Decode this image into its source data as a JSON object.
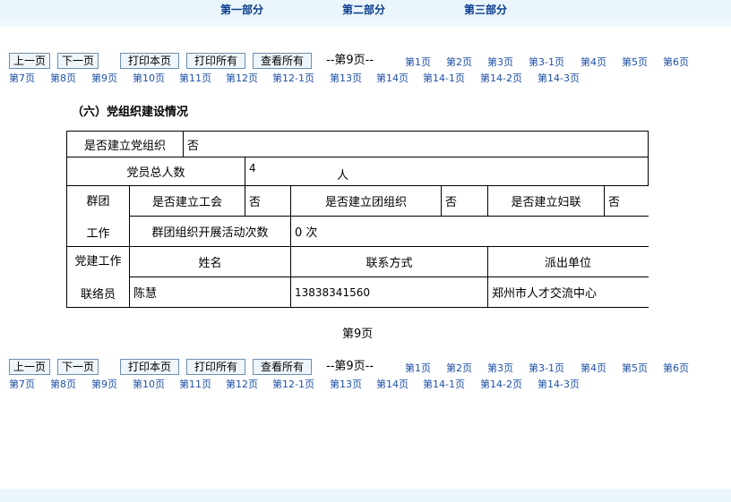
{
  "top_nav": {
    "part1": "第一部分",
    "part2": "第二部分",
    "part3": "第三部分"
  },
  "nav": {
    "prev": "上一页",
    "next": "下一页",
    "print_page": "打印本页",
    "print_all": "打印所有",
    "view_all": "查看所有",
    "current_page": "--第9页--",
    "pages": [
      "第1页",
      "第2页",
      "第3页",
      "第3-1页",
      "第4页",
      "第5页",
      "第6页",
      "第7页",
      "第8页",
      "第9页",
      "第10页",
      "第11页",
      "第12页",
      "第12-1页",
      "第13页",
      "第14页",
      "第14-1页",
      "第14-2页",
      "第14-3页"
    ]
  },
  "section": {
    "title": "（六）党组织建设情况",
    "q_party_org": "是否建立党组织",
    "a_party_org": "否",
    "q_member_count": "党员总人数",
    "a_member_count": "4",
    "member_unit": "人",
    "mass_org_label_1": "群团",
    "mass_org_label_2": "工作",
    "q_union": "是否建立工会",
    "a_union": "否",
    "q_league": "是否建立团组织",
    "a_league": "否",
    "q_women": "是否建立妇联",
    "a_women": "否",
    "q_activities": "群团组织开展活动次数",
    "a_activities": "0 次",
    "liaison_label_1": "党建工作",
    "liaison_label_2": "联络员",
    "col_name": "姓名",
    "col_contact": "联系方式",
    "col_unit": "派出单位",
    "liaison_name": "陈慧",
    "liaison_phone": "13838341560",
    "liaison_unit": "郑州市人才交流中心"
  },
  "footer_page": "第9页"
}
